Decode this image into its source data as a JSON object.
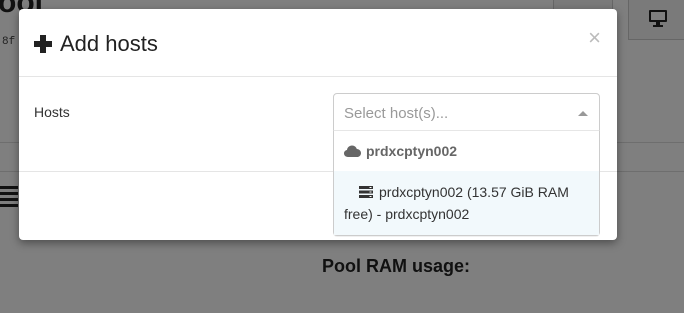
{
  "background": {
    "title": "ool",
    "subtitle": "8f"
  },
  "modal": {
    "title": "Add hosts",
    "close_glyph": "×",
    "field_label": "Hosts",
    "select_placeholder": "Select host(s)...",
    "group_label": "prdxcptyn002",
    "option_label": "prdxcptyn002 (13.57 GiB RAM free) - prdxcptyn002"
  },
  "page_below": {
    "ram_label": "Pool RAM usage:"
  },
  "icons": {
    "title": "plus-icon",
    "group": "cloud-icon",
    "option": "server-icon",
    "topbar_right": "monitor-icon",
    "topbar_left": "database-icon",
    "background_list": "list-icon"
  },
  "colors": {
    "overlay": "#000000",
    "option_highlight": "#f2f9fc",
    "placeholder": "#999999"
  }
}
